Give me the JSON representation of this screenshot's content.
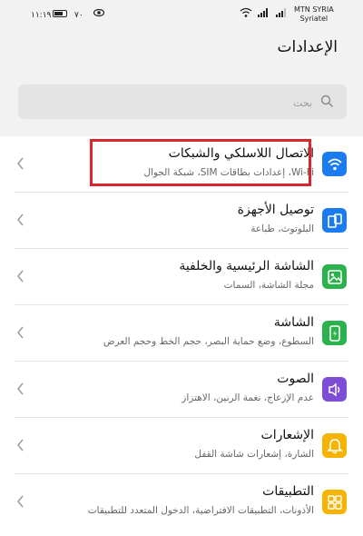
{
  "colors": {
    "accent": "#1b7cf2",
    "yellow": "#f6b400",
    "green": "#2bb24c",
    "purple": "#7d4dd8",
    "highlight": "#d9262c"
  },
  "status": {
    "time": "١١:١٩",
    "battery_percent": "٧٠",
    "carrier_name": "MTN SYRIA",
    "carrier_name_2": "Syriatel"
  },
  "header": {
    "title": "الإعدادات"
  },
  "search": {
    "placeholder": "بحث"
  },
  "items": [
    {
      "title": "الاتصال اللاسلكي والشبكات",
      "subtitle": "Wi-Fi، إعدادات بطاقات SIM، شبكة الجوال",
      "icon": "wifi-icon",
      "color": "#1b7cf2"
    },
    {
      "title": "توصيل الأجهزة",
      "subtitle": "البلوتوث، طباعة",
      "icon": "device-connection-icon",
      "color": "#1b7cf2"
    },
    {
      "title": "الشاشة الرئيسية والخلفية",
      "subtitle": "مجلة الشاشة، السمات",
      "icon": "wallpaper-icon",
      "color": "#2bb24c"
    },
    {
      "title": "الشاشة",
      "subtitle": "السطوع، وضع حماية البصر، حجم الخط وحجم العرض",
      "icon": "display-icon",
      "color": "#2bb24c"
    },
    {
      "title": "الصوت",
      "subtitle": "عدم الإزعاج، نغمة الرنين، الاهتزاز",
      "icon": "sound-icon",
      "color": "#7d4dd8"
    },
    {
      "title": "الإشعارات",
      "subtitle": "الشارة، إشعارات شاشة القفل",
      "icon": "bell-icon",
      "color": "#f6b400"
    },
    {
      "title": "التطبيقات",
      "subtitle": "الأذونات، التطبيقات الافتراضية، الدخول المتعدد للتطبيقات",
      "icon": "apps-icon",
      "color": "#f6b400"
    }
  ]
}
